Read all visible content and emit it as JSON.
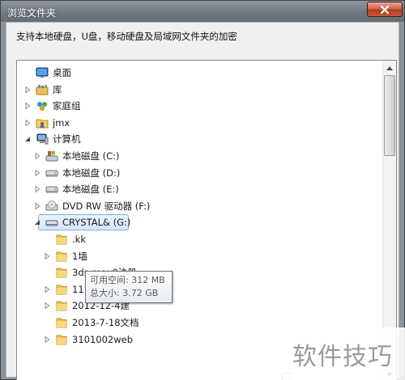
{
  "window": {
    "title": "浏览文件夹",
    "description": "支持本地硬盘，U盘，移动硬盘及局域网文件夹的加密"
  },
  "tree": [
    {
      "label": "桌面",
      "icon": "desktop-icon",
      "expander": "none",
      "indent": 0
    },
    {
      "label": "库",
      "icon": "library-icon",
      "expander": "collapsed",
      "indent": 0
    },
    {
      "label": "家庭组",
      "icon": "homegroup-icon",
      "expander": "collapsed",
      "indent": 0
    },
    {
      "label": "jmx",
      "icon": "user-folder-icon",
      "expander": "collapsed",
      "indent": 0
    },
    {
      "label": "计算机",
      "icon": "computer-icon",
      "expander": "expanded",
      "indent": 0
    },
    {
      "label": "本地磁盘 (C:)",
      "icon": "system-drive-icon",
      "expander": "collapsed",
      "indent": 1
    },
    {
      "label": "本地磁盘 (D:)",
      "icon": "hard-drive-icon",
      "expander": "collapsed",
      "indent": 1
    },
    {
      "label": "本地磁盘 (E:)",
      "icon": "hard-drive-icon",
      "expander": "collapsed",
      "indent": 1
    },
    {
      "label": "DVD RW 驱动器 (F:)",
      "icon": "dvd-drive-icon",
      "expander": "collapsed",
      "indent": 1
    },
    {
      "label": "CRYSTAL& (G:)",
      "icon": "removable-drive-icon",
      "expander": "expanded",
      "indent": 1,
      "selected": true
    },
    {
      "label": ".kk",
      "icon": "folder-icon",
      "expander": "none",
      "indent": 2
    },
    {
      "label": "1墙",
      "icon": "folder-icon",
      "expander": "collapsed",
      "indent": 2
    },
    {
      "label": "3ds max8注册",
      "icon": "folder-icon",
      "expander": "none",
      "indent": 2
    },
    {
      "label": "111",
      "icon": "folder-icon",
      "expander": "collapsed",
      "indent": 2
    },
    {
      "label": "2012-12-4建",
      "icon": "folder-icon",
      "expander": "collapsed",
      "indent": 2
    },
    {
      "label": "2013-7-18文档",
      "icon": "folder-icon",
      "expander": "none",
      "indent": 2
    },
    {
      "label": "3101002web",
      "icon": "folder-icon",
      "expander": "collapsed",
      "indent": 2
    }
  ],
  "tooltip": {
    "free_space": "可用空间: 312 MB",
    "total_size": "总大小: 3.72 GB"
  },
  "watermark": "软件技巧"
}
